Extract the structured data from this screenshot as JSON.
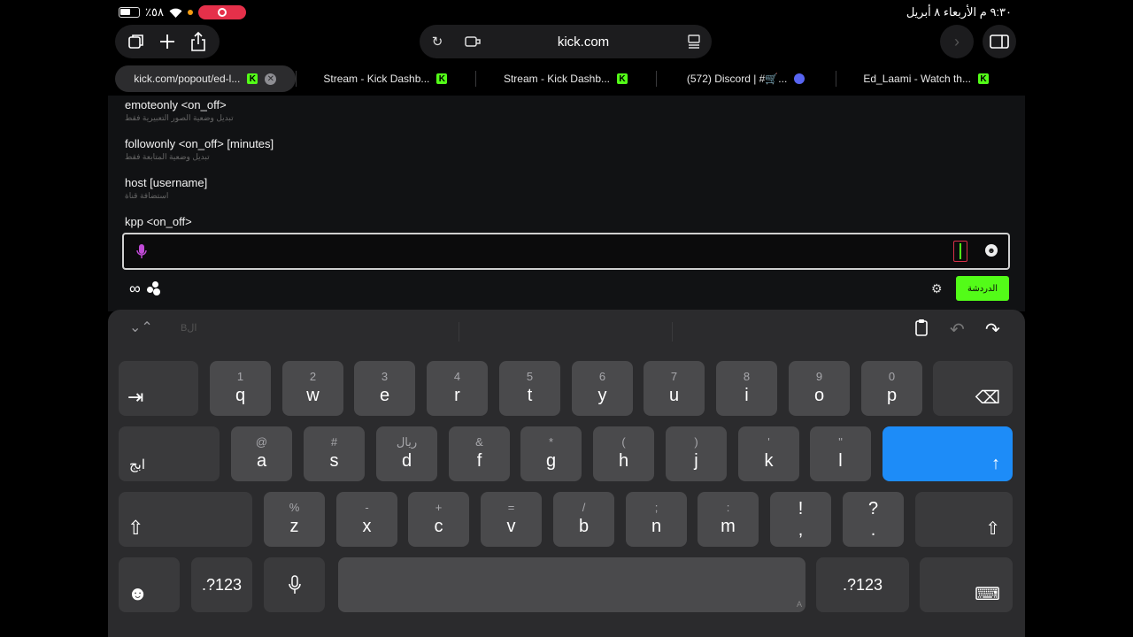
{
  "status_bar": {
    "battery_text": "٪٥٨",
    "datetime": "٩:٣٠ م  الأربعاء ٨ أبريل"
  },
  "browser": {
    "url": "kick.com",
    "tabs": [
      {
        "label": "kick.com/popout/ed-l...",
        "icon": "kick-icon",
        "active": true
      },
      {
        "label": "Stream - Kick Dashb...",
        "icon": "kick-icon",
        "active": false
      },
      {
        "label": "Stream - Kick Dashb...",
        "icon": "kick-icon",
        "active": false
      },
      {
        "label": "(572) Discord | #🛒...",
        "icon": "discord-icon",
        "active": false
      },
      {
        "label": "Ed_Laami - Watch th...",
        "icon": "kick-icon",
        "active": false
      }
    ]
  },
  "commands": [
    {
      "name": "emoteonly <on_off>",
      "desc": "تبديل وضعية الصور التعبيرية فقط"
    },
    {
      "name": "followonly <on_off> [minutes]",
      "desc": "تبديل وضعية المتابعة فقط"
    },
    {
      "name": "host [username]",
      "desc": "استضافة قناة"
    },
    {
      "name": "kpp <on_off>",
      "desc": ""
    }
  ],
  "chat": {
    "input_value": "/",
    "send_label": "الدردشة",
    "accent_color": "#53fc18"
  },
  "keyboard": {
    "suggestion": "Bال",
    "row1": [
      {
        "sec": "1",
        "pri": "q"
      },
      {
        "sec": "2",
        "pri": "w"
      },
      {
        "sec": "3",
        "pri": "e"
      },
      {
        "sec": "4",
        "pri": "r"
      },
      {
        "sec": "5",
        "pri": "t"
      },
      {
        "sec": "6",
        "pri": "y"
      },
      {
        "sec": "7",
        "pri": "u"
      },
      {
        "sec": "8",
        "pri": "i"
      },
      {
        "sec": "9",
        "pri": "o"
      },
      {
        "sec": "0",
        "pri": "p"
      }
    ],
    "row2": [
      {
        "sec": "@",
        "pri": "a"
      },
      {
        "sec": "#",
        "pri": "s"
      },
      {
        "sec": "ريال",
        "pri": "d"
      },
      {
        "sec": "&",
        "pri": "f"
      },
      {
        "sec": "*",
        "pri": "g"
      },
      {
        "sec": "(",
        "pri": "h"
      },
      {
        "sec": ")",
        "pri": "j"
      },
      {
        "sec": "'",
        "pri": "k"
      },
      {
        "sec": "\"",
        "pri": "l"
      }
    ],
    "row3": [
      {
        "sec": "%",
        "pri": "z"
      },
      {
        "sec": "-",
        "pri": "x"
      },
      {
        "sec": "+",
        "pri": "c"
      },
      {
        "sec": "=",
        "pri": "v"
      },
      {
        "sec": "/",
        "pri": "b"
      },
      {
        "sec": ";",
        "pri": "n"
      },
      {
        "sec": ":",
        "pri": "m"
      },
      {
        "sec": "!",
        "pri": ","
      },
      {
        "sec": "?",
        "pri": "."
      }
    ],
    "lang_label": "ابج",
    "numbers_label": ".?123",
    "space_hint": "A"
  }
}
